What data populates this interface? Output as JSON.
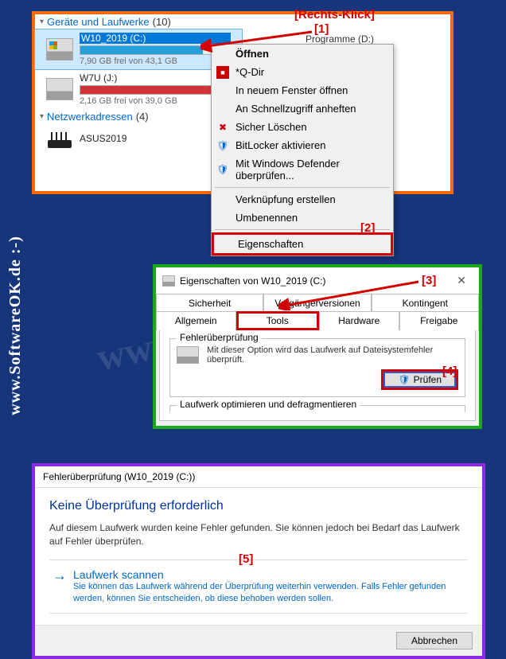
{
  "watermark": "www.softwareok.de",
  "sidebar": "www.SoftwareOK.de :-)",
  "annotations": {
    "rightClick": "[Rechts-Klick]",
    "a1": "[1]",
    "a2": "[2]",
    "a3": "[3]",
    "a4": "[4]",
    "a5": "[5]"
  },
  "explorer": {
    "section1": {
      "label": "Geräte und Laufwerke",
      "count": "(10)"
    },
    "section2": {
      "label": "Netzwerkadressen",
      "count": "(4)"
    },
    "drives": [
      {
        "name": "W10_2019 (C:)",
        "free": "7,90 GB frei von 43,1 GB",
        "fillPct": 82
      },
      {
        "name": "W7U (J:)",
        "free": "2,16 GB frei von 39,0 GB",
        "fillPct": 94
      }
    ],
    "sideDrive": "Programme (D:)",
    "network": [
      {
        "name": "ASUS2019"
      }
    ]
  },
  "contextMenu": {
    "open": "Öffnen",
    "qdir": "*Q-Dir",
    "newWindow": "In neuem Fenster öffnen",
    "pinQuick": "An Schnellzugriff anheften",
    "secureDelete": "Sicher Löschen",
    "bitlocker": "BitLocker aktivieren",
    "defender": "Mit Windows Defender überprüfen...",
    "shortcut": "Verknüpfung erstellen",
    "rename": "Umbenennen",
    "properties": "Eigenschaften"
  },
  "props": {
    "title": "Eigenschaften von W10_2019 (C:)",
    "tabs": {
      "security": "Sicherheit",
      "prev": "Vorgängerversionen",
      "quota": "Kontingent",
      "general": "Allgemein",
      "tools": "Tools",
      "hardware": "Hardware",
      "sharing": "Freigabe"
    },
    "errorCheck": {
      "title": "Fehlerüberprüfung",
      "text": "Mit dieser Option wird das Laufwerk auf Dateisystemfehler überprüft.",
      "button": "Prüfen"
    },
    "optimize": "Laufwerk optimieren und defragmentieren"
  },
  "dialog": {
    "title": "Fehlerüberprüfung (W10_2019 (C:))",
    "heading": "Keine Überprüfung erforderlich",
    "text": "Auf diesem Laufwerk wurden keine Fehler gefunden. Sie können jedoch bei Bedarf das Laufwerk auf Fehler überprüfen.",
    "linkTitle": "Laufwerk scannen",
    "linkSub": "Sie können das Laufwerk während der Überprüfung weiterhin verwenden. Falls Fehler gefunden werden, können Sie entscheiden, ob diese behoben werden sollen.",
    "cancel": "Abbrechen"
  }
}
